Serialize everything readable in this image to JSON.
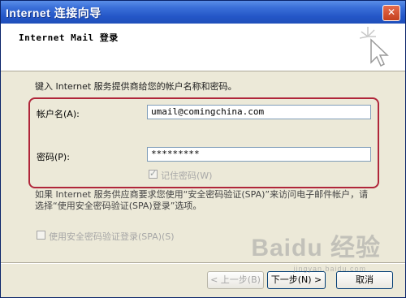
{
  "window": {
    "title": "Internet 连接向导",
    "close_glyph": "✕"
  },
  "header": {
    "heading": "Internet Mail 登录"
  },
  "content": {
    "intro": "键入 Internet 服务提供商给您的帐户名称和密码。",
    "account_label": "帐户名(A):",
    "account_value": "umail@comingchina.com",
    "password_label": "密码(P):",
    "password_value": "*********",
    "remember_label": "记住密码(W)",
    "remember_checked": true,
    "spa_text": "如果 Internet 服务供应商要求您使用“安全密码验证(SPA)”来访问电子邮件帐户，请选择“使用安全密码验证(SPA)登录”选项。",
    "spa_checkbox_label": "使用安全密码验证登录(SPA)(S)",
    "spa_checked": false
  },
  "buttons": {
    "back": "< 上一步(B)",
    "next": "下一步(N) >",
    "cancel": "取消"
  },
  "watermark": {
    "logo_text": "Baidu 经验",
    "url_text": "jingyan.baidu.com"
  },
  "colors": {
    "title_bar": "#2456c7",
    "highlight_border": "#b0263a",
    "dialog_bg": "#ece9d8"
  }
}
